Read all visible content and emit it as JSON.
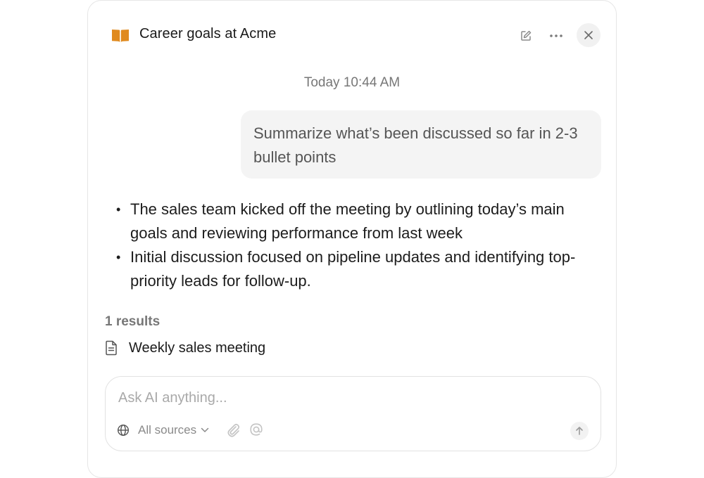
{
  "header": {
    "title": "Career goals at Acme",
    "icon": "book-icon",
    "accent_color": "#e08a1e"
  },
  "conversation": {
    "timestamp": "Today 10:44 AM",
    "user_message": "Summarize what’s been discussed so far in 2-3 bullet points",
    "answer_bullets": [
      "The sales team kicked off the meeting by outlining today’s main goals and reviewing performance from last week",
      "Initial discussion focused on pipeline updates and identifying top-priority leads for follow-up."
    ]
  },
  "results": {
    "count_label": "1 results",
    "items": [
      {
        "label": "Weekly sales meeting",
        "icon": "document-icon"
      }
    ]
  },
  "composer": {
    "placeholder": "Ask AI anything...",
    "value": "",
    "sources_label": "All sources"
  }
}
